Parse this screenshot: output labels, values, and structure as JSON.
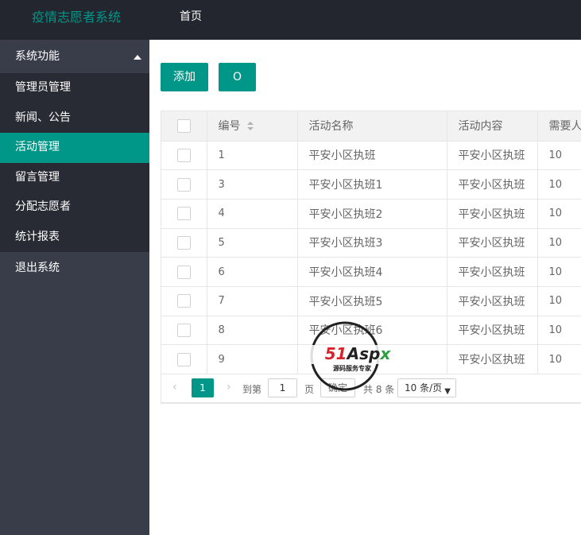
{
  "header": {
    "app_title": "疫情志愿者系统",
    "nav_home": "首页"
  },
  "sidebar": {
    "group_label": "系统功能",
    "items": [
      {
        "label": "管理员管理"
      },
      {
        "label": "新闻、公告"
      },
      {
        "label": "活动管理"
      },
      {
        "label": "留言管理"
      },
      {
        "label": "分配志愿者"
      },
      {
        "label": "统计报表"
      }
    ],
    "logout_label": "退出系统",
    "active_index": 2
  },
  "toolbar": {
    "add_label": "添加",
    "refresh_label": "O"
  },
  "table": {
    "headers": {
      "id": "编号",
      "name": "活动名称",
      "content": "活动内容",
      "need": "需要人数"
    },
    "rows": [
      {
        "id": "1",
        "name": "平安小区执班",
        "content": "平安小区执班",
        "need": "10"
      },
      {
        "id": "3",
        "name": "平安小区执班1",
        "content": "平安小区执班",
        "need": "10"
      },
      {
        "id": "4",
        "name": "平安小区执班2",
        "content": "平安小区执班",
        "need": "10"
      },
      {
        "id": "5",
        "name": "平安小区执班3",
        "content": "平安小区执班",
        "need": "10"
      },
      {
        "id": "6",
        "name": "平安小区执班4",
        "content": "平安小区执班",
        "need": "10"
      },
      {
        "id": "7",
        "name": "平安小区执班5",
        "content": "平安小区执班",
        "need": "10"
      },
      {
        "id": "8",
        "name": "平安小区执班6",
        "content": "平安小区执班",
        "need": "10"
      },
      {
        "id": "9",
        "name": "",
        "content": "平安小区执班",
        "need": "10"
      }
    ]
  },
  "pager": {
    "prev": "‹",
    "current": "1",
    "next": "›",
    "goto_label": "到第",
    "goto_value": "1",
    "page_label": "页",
    "confirm_label": "确定",
    "total_label": "共 8 条",
    "page_size": "10 条/页"
  },
  "watermark": {
    "brand": "51Aspx",
    "tagline": "源码服务专家"
  },
  "colors": {
    "accent": "#009688",
    "header_bg": "#23262e",
    "sidebar_bg": "#393d49",
    "submenu_bg": "#282b33"
  }
}
